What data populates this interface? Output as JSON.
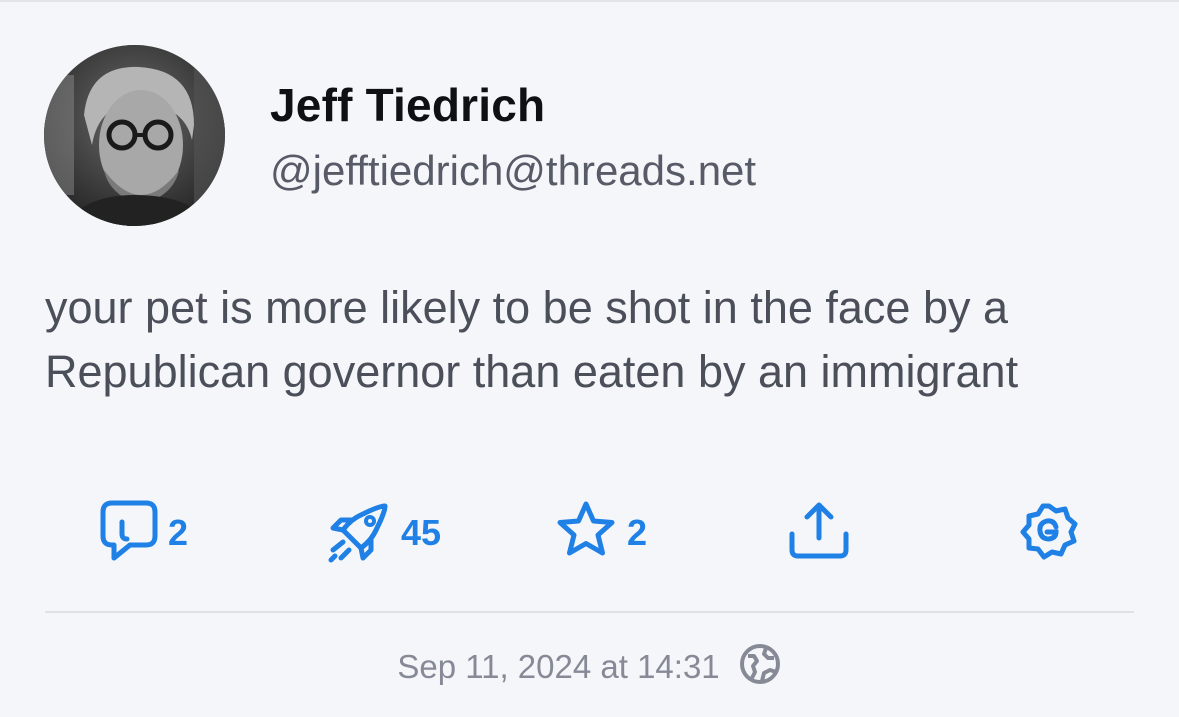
{
  "post": {
    "author_name": "Jeff Tiedrich",
    "author_handle": "@jefftiedrich@threads.net",
    "text": "your pet is more likely to be shot in the face by a Republican governor than eaten by an immigrant",
    "timestamp": "Sep 11, 2024 at 14:31",
    "visibility_icon": "globe-icon"
  },
  "actions": [
    {
      "name": "reply",
      "icon": "reply-icon",
      "count": "2"
    },
    {
      "name": "boost",
      "icon": "rocket-icon",
      "count": "45"
    },
    {
      "name": "favorite",
      "icon": "star-icon",
      "count": "2"
    },
    {
      "name": "share",
      "icon": "share-icon",
      "count": ""
    },
    {
      "name": "fediverse",
      "icon": "fediverse-icon",
      "count": ""
    }
  ],
  "colors": {
    "accent": "#1f80e6",
    "background": "#f5f6f9",
    "name": "#0f1014",
    "handle": "#565b67",
    "body_text": "#4a4f5a",
    "timestamp": "#858a96"
  }
}
